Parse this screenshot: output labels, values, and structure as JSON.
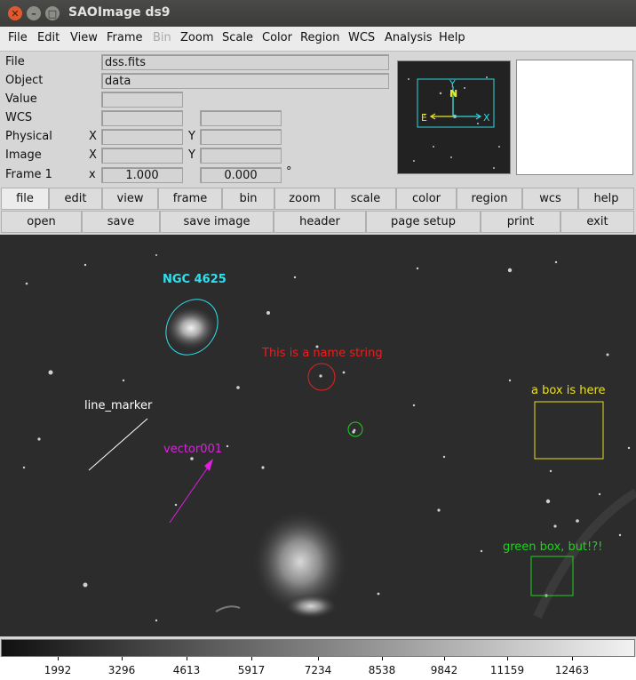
{
  "window": {
    "title": "SAOImage ds9"
  },
  "menubar": [
    {
      "label": "File"
    },
    {
      "label": "Edit"
    },
    {
      "label": "View"
    },
    {
      "label": "Frame"
    },
    {
      "label": "Bin",
      "disabled": true
    },
    {
      "label": "Zoom"
    },
    {
      "label": "Scale"
    },
    {
      "label": "Color"
    },
    {
      "label": "Region"
    },
    {
      "label": "WCS"
    },
    {
      "label": "Analysis"
    },
    {
      "label": "Help"
    }
  ],
  "info": {
    "file_label": "File",
    "file_value": "dss.fits",
    "object_label": "Object",
    "object_value": "data",
    "value_label": "Value",
    "wcs_label": "WCS",
    "physical_label": "Physical",
    "image_label": "Image",
    "frame_label": "Frame 1",
    "axis_x_upper": "X",
    "axis_y_upper": "Y",
    "axis_x_lower": "x",
    "zoom_value": "1.000",
    "angle_value": "0.000",
    "degree_symbol": "°"
  },
  "panner": {
    "north": "N",
    "east": "E",
    "x_axis": "X",
    "y_axis": "Y",
    "compass_color": "#e8e82a",
    "box_color": "#2fd8e0"
  },
  "buttons_row1": [
    {
      "label": "file",
      "active": true
    },
    {
      "label": "edit"
    },
    {
      "label": "view"
    },
    {
      "label": "frame"
    },
    {
      "label": "bin"
    },
    {
      "label": "zoom"
    },
    {
      "label": "scale"
    },
    {
      "label": "color"
    },
    {
      "label": "region"
    },
    {
      "label": "wcs"
    },
    {
      "label": "help"
    }
  ],
  "buttons_row2": [
    {
      "label": "open"
    },
    {
      "label": "save"
    },
    {
      "label": "save image"
    },
    {
      "label": "header"
    },
    {
      "label": "page setup"
    },
    {
      "label": "print"
    },
    {
      "label": "exit"
    }
  ],
  "regions": {
    "ellipse_label": "NGC 4625",
    "ellipse_color": "#2fe0ee",
    "circle_label": "This is a name string",
    "circle_color": "#e82020",
    "line_label": "line_marker",
    "line_color": "#ffffff",
    "vector_label": "vector001",
    "vector_color": "#e020e0",
    "box_label": "a box is here",
    "box_color": "#e8e020",
    "green_box_label": "green box, but!?!",
    "green_color": "#20d020"
  },
  "colorbar": {
    "ticks": [
      "1992",
      "3296",
      "4613",
      "5917",
      "7234",
      "8538",
      "9842",
      "11159",
      "12463"
    ]
  }
}
